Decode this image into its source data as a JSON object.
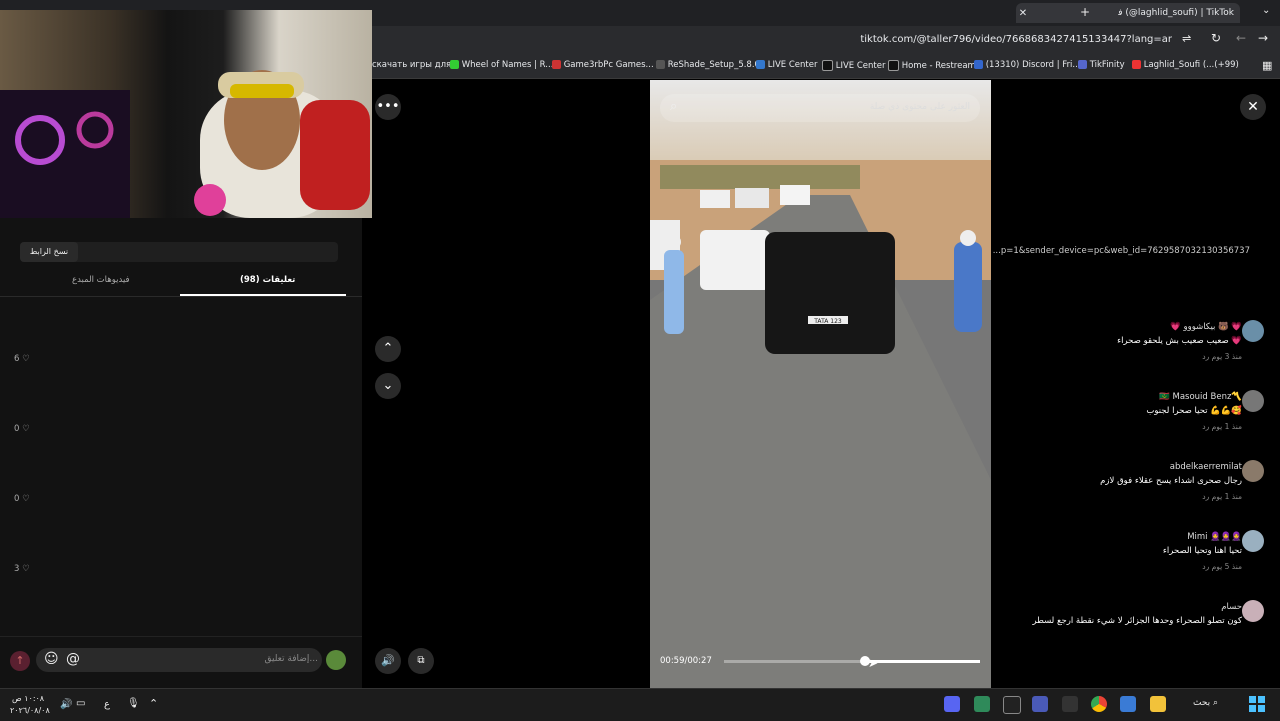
{
  "browser": {
    "tab_title": "ﻓ (@laghlid_soufi) | TikTok",
    "url": "tiktok.com/@taller796/video/7668683427415133447?lang=ar",
    "bookmarks": [
      "скачать игры для...",
      "Wheel of Names | R...",
      "Game3rbPc Games...",
      "ReShade_Setup_5.8.0",
      "LIVE Center",
      "LIVE Center",
      "Home - Restream",
      "(13310) Discord | Fri...",
      "TikFinity",
      "Laghlid_Soufi (...(+99)"
    ]
  },
  "left_panel": {
    "copy_button": "نسخ الرابط",
    "copy_link": "...p=1&sender_device=pc&web_id=7629587032130356737",
    "tabs": {
      "comments": "تعليقات (98)",
      "creator_videos": "فيديوهات المبدع"
    },
    "comments": [
      {
        "name": "💗 بيكاشووو 🐻 💗",
        "text": "صعيب صعيب بش يلحقو صحراء 💗",
        "meta": "منذ 3 يوم   رد",
        "likes": "6 ♡"
      },
      {
        "name": "🇲🇷 Masouid Benz〽️",
        "text": "تحيا صحرا لجنوب 💪💪🥰",
        "meta": "منذ 1 يوم   رد",
        "likes": "0 ♡"
      },
      {
        "name": "abdelkaerremilat",
        "text": "رجال صحرى اشداء يسح عقلاء فوق لازم",
        "meta": "منذ 1 يوم   رد",
        "likes": "0 ♡"
      },
      {
        "name": "Mimi 🧕🧕🧕",
        "text": "تحيا اهنا وتحيا الصحراء",
        "meta": "منذ 5 يوم   رد",
        "likes": "3 ♡"
      },
      {
        "name": "حسام",
        "text": "كون تصلو الصحراء وحدها الجزائر لا شيء نقطة ارجع لسطر",
        "meta": "",
        "likes": ""
      }
    ],
    "input_placeholder": "إضافة تعليق..."
  },
  "video": {
    "search_placeholder": "العثور على محتوى ذي صلة",
    "time": "00:59/00:27",
    "progress_fraction": 0.55,
    "plate": "TATA 123"
  },
  "taskbar": {
    "time": "١٠:٠٨ ص",
    "date": "٢٠٢٦/٠٨/٠٨",
    "lang": "ع",
    "search_label": "بحث"
  },
  "colors": {
    "accent_red": "#fe2c55",
    "video_road": "#777777",
    "sand": "#c9a27a"
  }
}
